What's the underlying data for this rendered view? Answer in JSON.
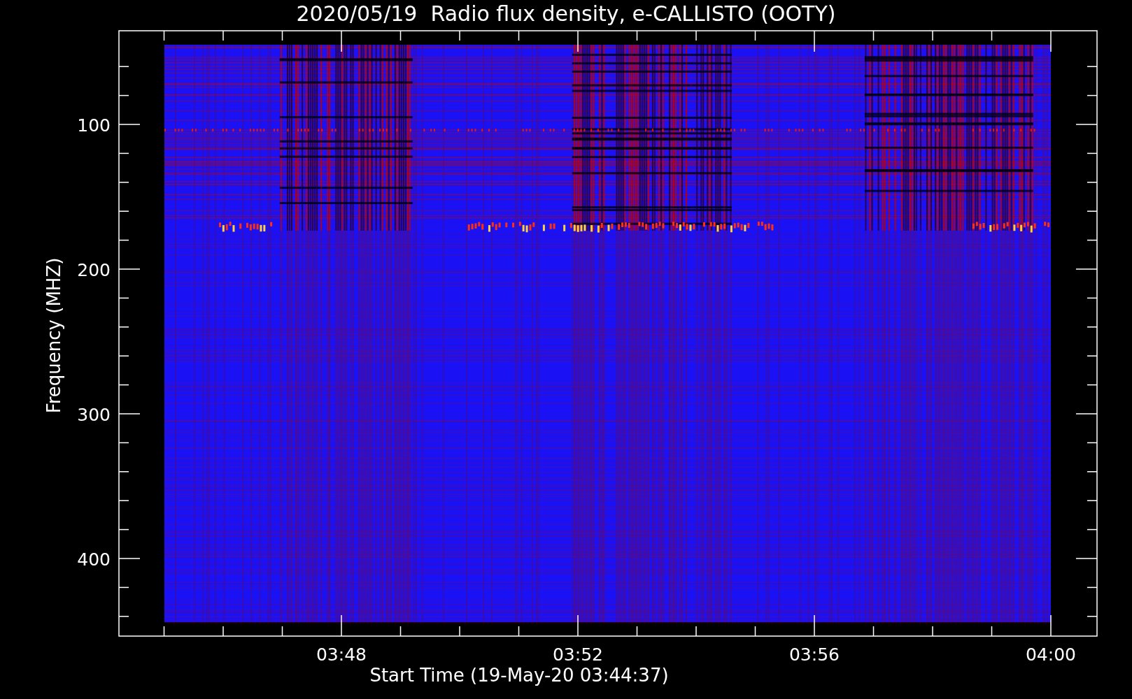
{
  "title": "2020/05/19  Radio flux density, e-CALLISTO (OOTY)",
  "plot": {
    "ylabel": "Frequency (MHZ)",
    "xlabel": "Start Time (19-May-20 03:44:37)",
    "yticks": [
      "100",
      "200",
      "300",
      "400"
    ],
    "xticks": [
      "03:48",
      "03:52",
      "03:56",
      "04:00"
    ]
  }
}
